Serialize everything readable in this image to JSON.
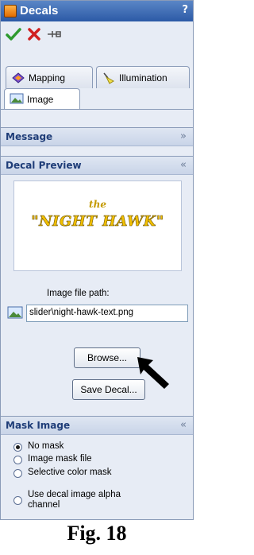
{
  "window": {
    "title": "Decals",
    "help": "?"
  },
  "toolbar": {
    "ok_icon": "checkmark-icon",
    "cancel_icon": "close-icon",
    "pin_icon": "pushpin-icon"
  },
  "tabs": [
    {
      "label": "Mapping",
      "icon": "mapping-icon"
    },
    {
      "label": "Illumination",
      "icon": "illumination-icon"
    }
  ],
  "active_tab": {
    "label": "Image",
    "icon": "image-icon"
  },
  "groups": {
    "message": {
      "title": "Message",
      "chevron": "»"
    },
    "decal_preview": {
      "title": "Decal Preview",
      "chevron": "«"
    },
    "mask_image": {
      "title": "Mask Image",
      "chevron": "«"
    }
  },
  "preview": {
    "small_text": "the",
    "main_text": "\"NIGHT HAWK\""
  },
  "image_file": {
    "label": "Image file path:",
    "value": "slider\\night-hawk-text.png"
  },
  "buttons": {
    "browse": "Browse...",
    "save_decal": "Save Decal..."
  },
  "mask_options": [
    {
      "label": "No mask",
      "selected": true
    },
    {
      "label": "Image mask file",
      "selected": false
    },
    {
      "label": "Selective color mask",
      "selected": false
    },
    {
      "label": "Use decal image alpha",
      "label2": "channel",
      "selected": false
    }
  ],
  "caption": "Fig. 18",
  "colors": {
    "accent": "#2c5aa6",
    "group_title": "#1f3d78",
    "preview_text": "#f2c000"
  }
}
